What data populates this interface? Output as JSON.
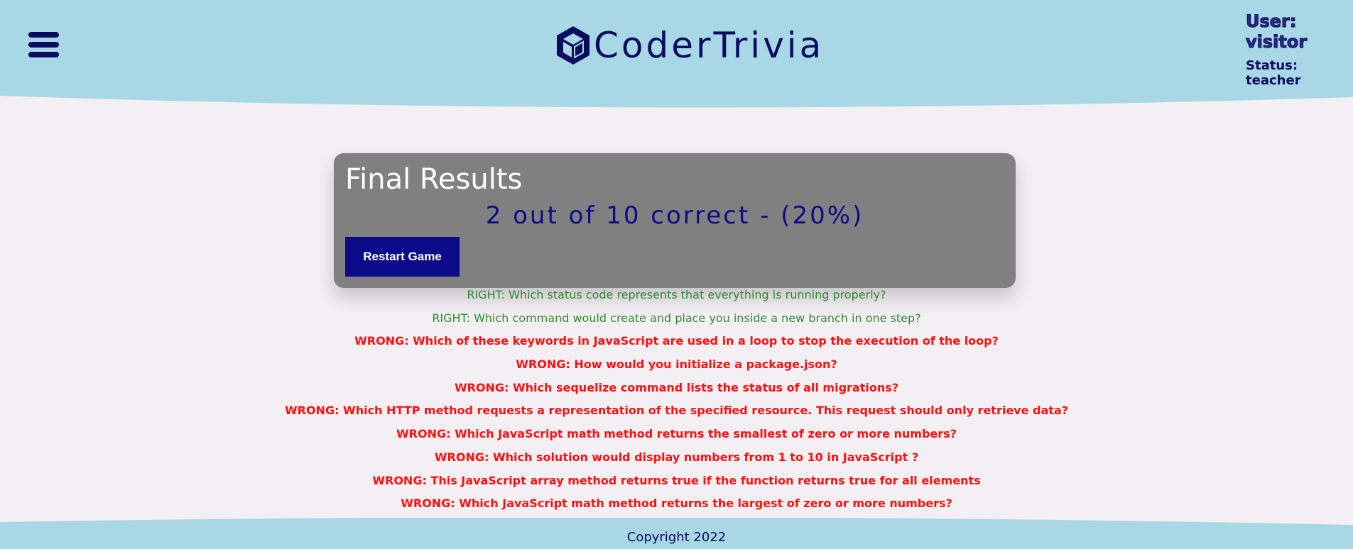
{
  "header": {
    "logo_text": "CoderTrivia",
    "menu_icon": "hamburger-menu-icon",
    "logo_icon": "cube-icon",
    "user_label": "User:",
    "user_name": "visitor",
    "status": "Status: teacher"
  },
  "card": {
    "title": "Final Results",
    "score": "2 out of 10 correct - (20%)",
    "restart_label": "Restart Game"
  },
  "results": [
    {
      "text": "RIGHT: Which status code represents that everything is running properly?",
      "status": "right"
    },
    {
      "text": "RIGHT: Which command would create and place you inside a new branch in one step?",
      "status": "right"
    },
    {
      "text": "WRONG: Which of these keywords in JavaScript are used in a loop to stop the execution of the loop?",
      "status": "wrong"
    },
    {
      "text": "WRONG: How would you initialize a package.json?",
      "status": "wrong"
    },
    {
      "text": "WRONG: Which sequelize command lists the status of all migrations?",
      "status": "wrong"
    },
    {
      "text": "WRONG: Which HTTP method requests a representation of the specified resource. This request should only retrieve data?",
      "status": "wrong"
    },
    {
      "text": "WRONG: Which JavaScript math method returns the smallest of zero or more numbers?",
      "status": "wrong"
    },
    {
      "text": "WRONG: Which solution would display numbers from 1 to 10 in JavaScript ?",
      "status": "wrong"
    },
    {
      "text": "WRONG: This JavaScript array method returns true if the function returns true for all elements",
      "status": "wrong"
    },
    {
      "text": "WRONG: Which JavaScript math method returns the largest of zero or more numbers?",
      "status": "wrong"
    }
  ],
  "footer": {
    "copyright": "Copyright 2022"
  },
  "colors": {
    "header_bg": "#a8d8e6",
    "navy": "#0a0a5e",
    "right": "#2f8a2f",
    "wrong": "#ff1010",
    "card_bg": "#808080"
  }
}
